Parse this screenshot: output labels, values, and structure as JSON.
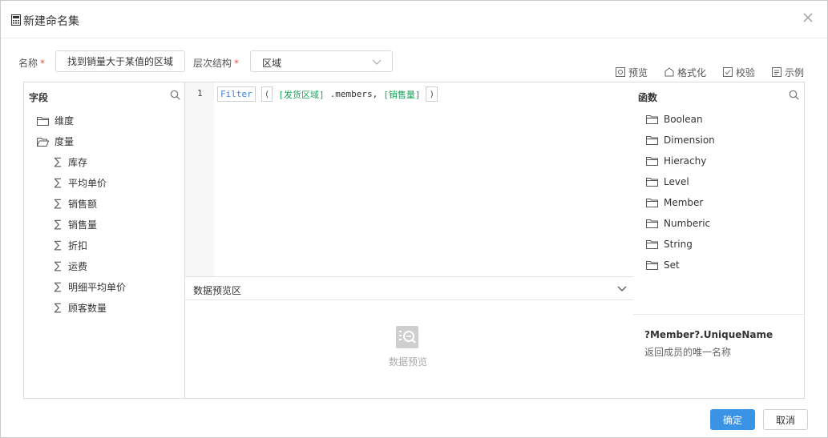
{
  "dialog": {
    "title": "新建命名集"
  },
  "form": {
    "name_label": "名称",
    "name_value": "找到销量大于某值的区域",
    "hierarchy_label": "层次结构",
    "hierarchy_value": "区域",
    "required_mark": "*"
  },
  "toolbar": {
    "preview": "预览",
    "format": "格式化",
    "validate": "校验",
    "example": "示例"
  },
  "fields_panel": {
    "title": "字段",
    "folders": [
      {
        "label": "维度",
        "icon": "folder-icon"
      },
      {
        "label": "度量",
        "icon": "folder-open-icon"
      }
    ],
    "measures": [
      "库存",
      "平均单价",
      "销售额",
      "销售量",
      "折扣",
      "运费",
      "明细平均单价",
      "顾客数量"
    ]
  },
  "editor": {
    "line_number": "1",
    "tokens": {
      "fn": "Filter",
      "open_paren": "(",
      "field1": "[发货区域]",
      "members": ".members,",
      "field2": "[销售量]",
      "close_paren": ")"
    }
  },
  "preview": {
    "title": "数据预览区",
    "empty_text": "数据预览"
  },
  "functions_panel": {
    "title": "函数",
    "groups": [
      "Boolean",
      "Dimension",
      "Hierachy",
      "Level",
      "Member",
      "Numberic",
      "String",
      "Set"
    ],
    "selected_signature": "?Member?.UniqueName",
    "selected_description": "返回成员的唯一名称"
  },
  "footer": {
    "ok": "确定",
    "cancel": "取消"
  },
  "colors": {
    "primary": "#3b93e6",
    "function_token": "#3f7fd6",
    "field_token": "#1aa35a",
    "required": "#e5534b"
  }
}
